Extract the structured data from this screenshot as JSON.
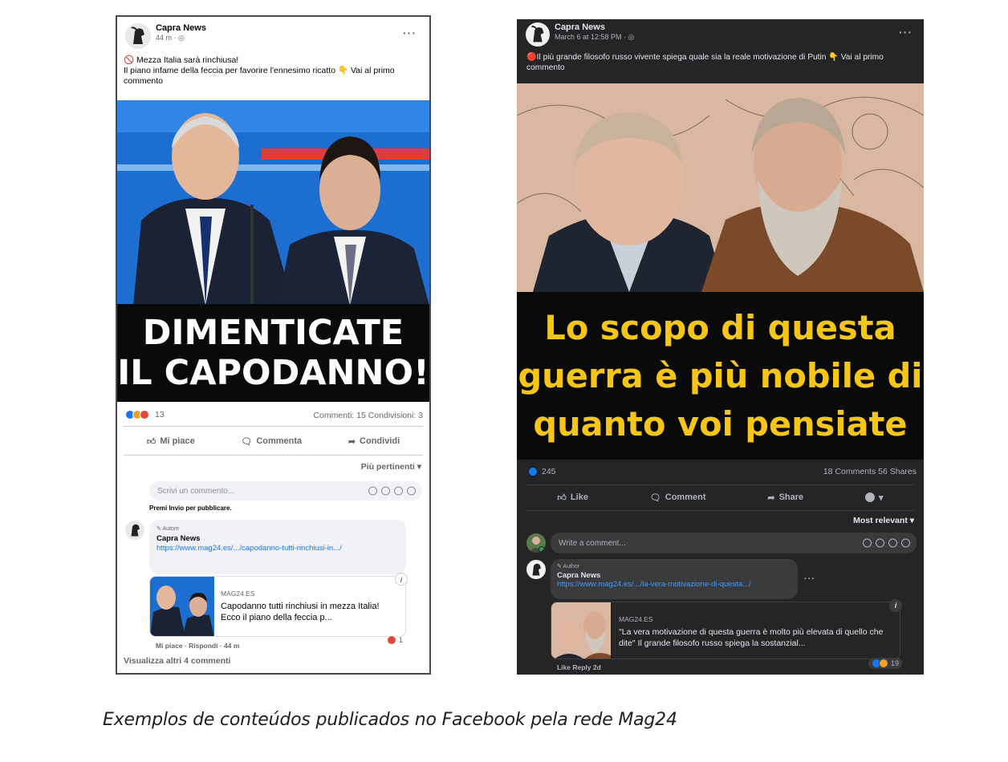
{
  "caption": "Exemplos de conteúdos publicados no Facebook pela rede Mag24",
  "post_left": {
    "page_name": "Capra News",
    "time": "44 m · ◎",
    "line1": "🚫 Mezza Italia sarà rinchiusa!",
    "line2": "Il piano infame della feccia per favorire l'ennesimo ricatto 👇 Vai al primo commento",
    "headline_1": "DIMENTICATE",
    "headline_2": "IL CAPODANNO!",
    "reaction_count": "13",
    "comments_shares": "Commenti: 15  Condivisioni: 3",
    "like_label": "Mi piace",
    "comment_label": "Commenta",
    "share_label": "Condividi",
    "sort_label": "Più pertinenti ▾",
    "comment_placeholder": "Scrivi un commento...",
    "enter_hint": "Premi Invio per pubblicare.",
    "author_tag": "✎ Autore",
    "commenter": "Capra News",
    "link": "https://www.mag24.es/.../capodanno-tutti-rinchiusi-in.../",
    "preview_domain": "MAG24.ES",
    "preview_title": "Capodanno tutti rinchiusi in mezza Italia! Ecco il piano della feccia p...",
    "comment_meta": "Mi piace · Rispondi · 44 m",
    "comment_reactions": "1",
    "more_comments": "Visualizza altri 4 commenti"
  },
  "post_right": {
    "page_name": "Capra News",
    "time": "March 6 at 12:58 PM · ◎",
    "text": "🔴Il più grande filosofo russo vivente spiega quale sia la reale motivazione di Putin 👇 Vai al primo commento",
    "headline_1": "Lo scopo di questa",
    "headline_2": "guerra è più nobile di",
    "headline_3": "quanto voi pensiate",
    "reaction_count": "245",
    "comments_shares": "18 Comments  56 Shares",
    "like_label": "Like",
    "comment_label": "Comment",
    "share_label": "Share",
    "sort_label": "Most relevant ▾",
    "comment_placeholder": "Write a comment...",
    "author_tag": "✎ Author",
    "commenter": "Capra News",
    "link": "https://www.mag24.es/.../la-vera-motivazione-di-questa.../",
    "preview_domain": "MAG24.ES",
    "preview_title": "\"La vera motivazione di questa guerra è molto più elevata di quello che dite\" Il grande filosofo russo spiega la sostanzial...",
    "comment_meta": "Like   Reply   2d",
    "comment_reactions": "19"
  },
  "colors": {
    "fb_blue": "#1877f2",
    "headline_yellow": "#f5c518",
    "dark_card": "#242526"
  }
}
